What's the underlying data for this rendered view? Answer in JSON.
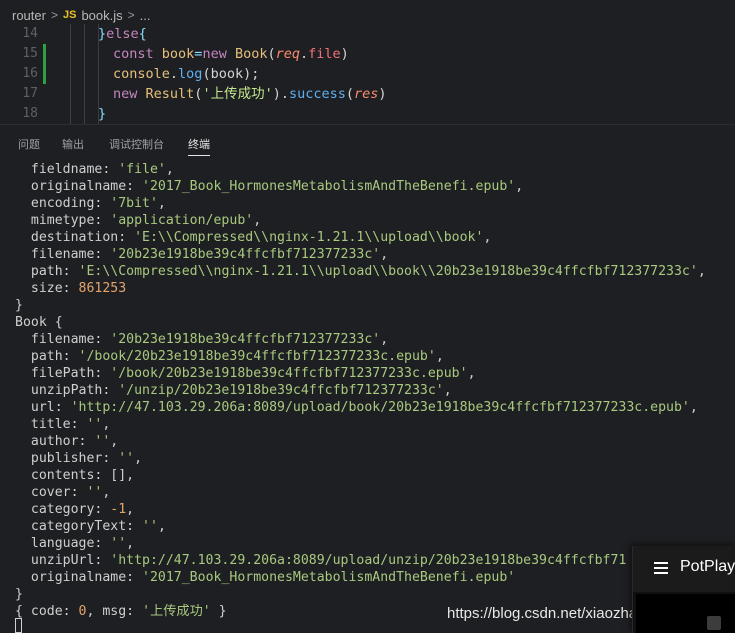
{
  "breadcrumb": {
    "folder": "router",
    "file_type_badge": "JS",
    "file": "book.js",
    "more": "..."
  },
  "editor": {
    "lines": [
      {
        "num": "14",
        "tokens": [
          {
            "c": "punc",
            "t": "}"
          },
          {
            "c": "kw",
            "t": "else"
          },
          {
            "c": "punc",
            "t": "{"
          }
        ]
      },
      {
        "num": "15",
        "tokens": [
          {
            "c": "kw",
            "t": "const "
          },
          {
            "c": "ident",
            "t": "book"
          },
          {
            "c": "punc",
            "t": "="
          },
          {
            "c": "kw",
            "t": "new "
          },
          {
            "c": "ident",
            "t": "Book"
          },
          {
            "c": "plain",
            "t": "("
          },
          {
            "c": "param",
            "t": "req"
          },
          {
            "c": "plain",
            "t": "."
          },
          {
            "c": "kw2",
            "t": "file"
          },
          {
            "c": "plain",
            "t": ")"
          }
        ]
      },
      {
        "num": "16",
        "tokens": [
          {
            "c": "ident",
            "t": "console"
          },
          {
            "c": "plain",
            "t": "."
          },
          {
            "c": "fn",
            "t": "log"
          },
          {
            "c": "plain",
            "t": "(book);"
          }
        ]
      },
      {
        "num": "17",
        "tokens": [
          {
            "c": "kw",
            "t": "new "
          },
          {
            "c": "ident",
            "t": "Result"
          },
          {
            "c": "plain",
            "t": "("
          },
          {
            "c": "str",
            "t": "'上传成功'"
          },
          {
            "c": "plain",
            "t": ")."
          },
          {
            "c": "fn",
            "t": "success"
          },
          {
            "c": "plain",
            "t": "("
          },
          {
            "c": "param",
            "t": "res"
          },
          {
            "c": "plain",
            "t": ")"
          }
        ]
      },
      {
        "num": "18",
        "tokens": [
          {
            "c": "punc",
            "t": "}"
          }
        ]
      }
    ]
  },
  "panel": {
    "tabs": [
      "问题",
      "输出",
      "调试控制台",
      "终端"
    ],
    "active_tab": "终端"
  },
  "terminal": {
    "lines": [
      [
        {
          "c": "",
          "t": "  fieldname: "
        },
        {
          "c": "t-str",
          "t": "'file'"
        },
        {
          "c": "",
          "t": ","
        }
      ],
      [
        {
          "c": "",
          "t": "  originalname: "
        },
        {
          "c": "t-str",
          "t": "'2017_Book_HormonesMetabolismAndTheBenefi.epub'"
        },
        {
          "c": "",
          "t": ","
        }
      ],
      [
        {
          "c": "",
          "t": "  encoding: "
        },
        {
          "c": "t-str",
          "t": "'7bit'"
        },
        {
          "c": "",
          "t": ","
        }
      ],
      [
        {
          "c": "",
          "t": "  mimetype: "
        },
        {
          "c": "t-str",
          "t": "'application/epub'"
        },
        {
          "c": "",
          "t": ","
        }
      ],
      [
        {
          "c": "",
          "t": "  destination: "
        },
        {
          "c": "t-str",
          "t": "'E:\\\\Compressed\\\\nginx-1.21.1\\\\upload\\\\book'"
        },
        {
          "c": "",
          "t": ","
        }
      ],
      [
        {
          "c": "",
          "t": "  filename: "
        },
        {
          "c": "t-str",
          "t": "'20b23e1918be39c4ffcfbf712377233c'"
        },
        {
          "c": "",
          "t": ","
        }
      ],
      [
        {
          "c": "",
          "t": "  path: "
        },
        {
          "c": "t-str",
          "t": "'E:\\\\Compressed\\\\nginx-1.21.1\\\\upload\\\\book\\\\20b23e1918be39c4ffcfbf712377233c'"
        },
        {
          "c": "",
          "t": ","
        }
      ],
      [
        {
          "c": "",
          "t": "  size: "
        },
        {
          "c": "t-num",
          "t": "861253"
        }
      ],
      [
        {
          "c": "",
          "t": "}"
        }
      ],
      [
        {
          "c": "",
          "t": "Book {"
        }
      ],
      [
        {
          "c": "",
          "t": "  filename: "
        },
        {
          "c": "t-str",
          "t": "'20b23e1918be39c4ffcfbf712377233c'"
        },
        {
          "c": "",
          "t": ","
        }
      ],
      [
        {
          "c": "",
          "t": "  path: "
        },
        {
          "c": "t-str",
          "t": "'/book/20b23e1918be39c4ffcfbf712377233c.epub'"
        },
        {
          "c": "",
          "t": ","
        }
      ],
      [
        {
          "c": "",
          "t": "  filePath: "
        },
        {
          "c": "t-str",
          "t": "'/book/20b23e1918be39c4ffcfbf712377233c.epub'"
        },
        {
          "c": "",
          "t": ","
        }
      ],
      [
        {
          "c": "",
          "t": "  unzipPath: "
        },
        {
          "c": "t-str",
          "t": "'/unzip/20b23e1918be39c4ffcfbf712377233c'"
        },
        {
          "c": "",
          "t": ","
        }
      ],
      [
        {
          "c": "",
          "t": "  url: "
        },
        {
          "c": "t-str",
          "t": "'http://47.103.29.206a:8089/upload/book/20b23e1918be39c4ffcfbf712377233c.epub'"
        },
        {
          "c": "",
          "t": ","
        }
      ],
      [
        {
          "c": "",
          "t": "  title: "
        },
        {
          "c": "t-str",
          "t": "''"
        },
        {
          "c": "",
          "t": ","
        }
      ],
      [
        {
          "c": "",
          "t": "  author: "
        },
        {
          "c": "t-str",
          "t": "''"
        },
        {
          "c": "",
          "t": ","
        }
      ],
      [
        {
          "c": "",
          "t": "  publisher: "
        },
        {
          "c": "t-str",
          "t": "''"
        },
        {
          "c": "",
          "t": ","
        }
      ],
      [
        {
          "c": "",
          "t": "  contents: [],"
        }
      ],
      [
        {
          "c": "",
          "t": "  cover: "
        },
        {
          "c": "t-str",
          "t": "''"
        },
        {
          "c": "",
          "t": ","
        }
      ],
      [
        {
          "c": "",
          "t": "  category: "
        },
        {
          "c": "t-num",
          "t": "-1"
        },
        {
          "c": "",
          "t": ","
        }
      ],
      [
        {
          "c": "",
          "t": "  categoryText: "
        },
        {
          "c": "t-str",
          "t": "''"
        },
        {
          "c": "",
          "t": ","
        }
      ],
      [
        {
          "c": "",
          "t": "  language: "
        },
        {
          "c": "t-str",
          "t": "''"
        },
        {
          "c": "",
          "t": ","
        }
      ],
      [
        {
          "c": "",
          "t": "  unzipUrl: "
        },
        {
          "c": "t-str",
          "t": "'http://47.103.29.206a:8089/upload/unzip/20b23e1918be39c4ffcfbf71"
        }
      ],
      [
        {
          "c": "",
          "t": "  originalname: "
        },
        {
          "c": "t-str",
          "t": "'2017_Book_HormonesMetabolismAndTheBenefi.epub'"
        }
      ],
      [
        {
          "c": "",
          "t": "}"
        }
      ],
      [
        {
          "c": "",
          "t": "{ code: "
        },
        {
          "c": "t-num",
          "t": "0"
        },
        {
          "c": "",
          "t": ", msg: "
        },
        {
          "c": "t-str",
          "t": "'上传成功'"
        },
        {
          "c": "",
          "t": " }"
        }
      ]
    ]
  },
  "watermark": {
    "text": "https://blog.csdn.net/xiaozhazhazhazha"
  },
  "potplayer": {
    "title": "PotPlayer"
  },
  "colors": {
    "background": "#1e1f22",
    "git_added": "#2ea043",
    "string": "#a8c97f",
    "number": "#e5a46b"
  }
}
